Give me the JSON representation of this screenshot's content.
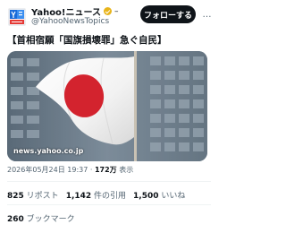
{
  "account": {
    "display_name": "Yahoo!ニュース",
    "name_extra": "–",
    "handle": "@YahooNewsTopics",
    "badge_color": "#e8b41a"
  },
  "actions": {
    "follow_label": "フォローする",
    "more_label": "…"
  },
  "tweet": {
    "text": "【首相宿願「国旗損壊罪」急ぐ自民】"
  },
  "media": {
    "caption": "news.yahoo.co.jp",
    "subject": "japanese-flag-photo"
  },
  "meta": {
    "timestamp": "2026年05月24日 19:37",
    "separator": "·",
    "views_count": "172万",
    "views_label": "表示"
  },
  "stats": {
    "reposts_count": "825",
    "reposts_label": "リポスト",
    "quotes_count": "1,142",
    "quotes_label": "件の引用",
    "likes_count": "1,500",
    "likes_label": "いいね",
    "bookmarks_count": "260",
    "bookmarks_label": "ブックマーク"
  },
  "colors": {
    "text_primary": "#0f1419",
    "text_secondary": "#536471",
    "flag_red": "#d3232e",
    "yahoo_blue": "#1a6ad8"
  }
}
